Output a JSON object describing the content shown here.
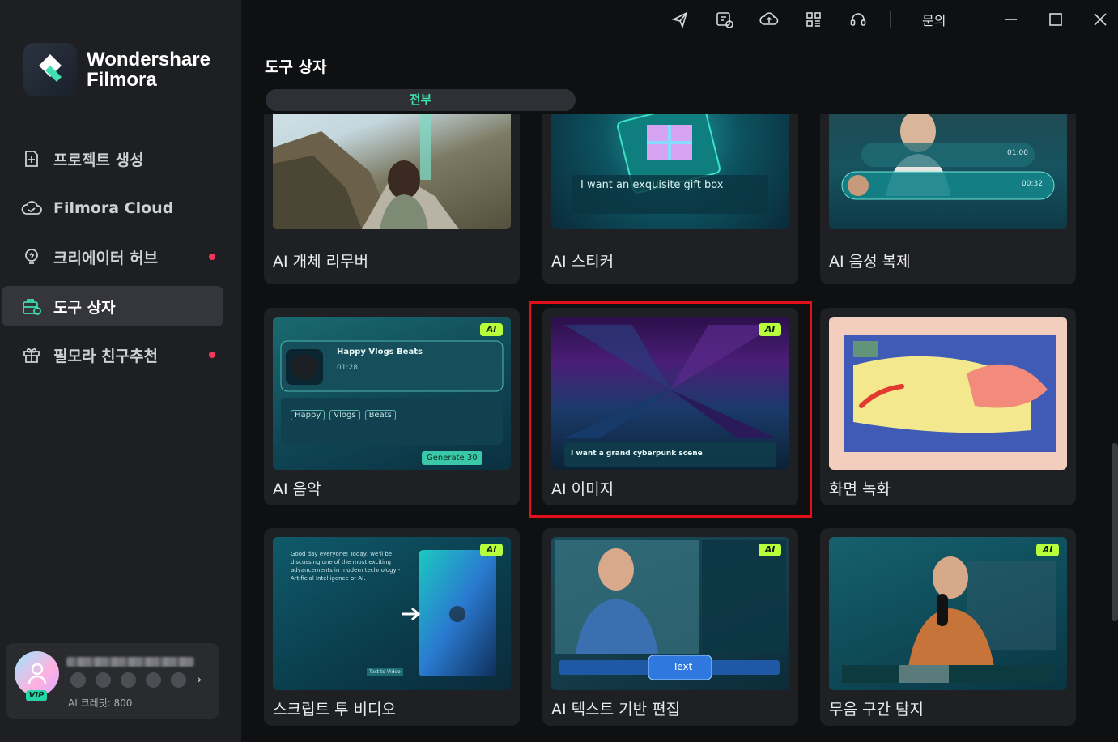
{
  "app": {
    "logo_line1": "Wondershare",
    "logo_line2": "Filmora"
  },
  "sidebar": {
    "items": [
      {
        "label": "프로젝트 생성",
        "icon": "add-project-icon",
        "active": false,
        "dot": false
      },
      {
        "label": "Filmora Cloud",
        "icon": "cloud-icon",
        "active": false,
        "dot": false
      },
      {
        "label": "크리에이터 허브",
        "icon": "bulb-icon",
        "active": false,
        "dot": true
      },
      {
        "label": "도구 상자",
        "icon": "toolbox-icon",
        "active": true,
        "dot": false
      },
      {
        "label": "필모라 친구추천",
        "icon": "gift-icon",
        "active": false,
        "dot": true
      }
    ],
    "user": {
      "vip_label": "VIP",
      "credits": "AI 크레딧: 800"
    }
  },
  "topbar": {
    "icons": [
      "send-icon",
      "feedback-icon",
      "cloud-upload-icon",
      "grid-icon",
      "headset-icon"
    ],
    "inquiry": "문의",
    "window_controls": [
      "minimize-icon",
      "maximize-icon",
      "close-icon"
    ]
  },
  "main": {
    "title": "도구 상자",
    "filter_tab": "전부",
    "ai_badge": "AI",
    "tools": [
      {
        "label": "AI 개체 리무버"
      },
      {
        "label": "AI 스티커",
        "prompt": "I want an exquisite gift box"
      },
      {
        "label": "AI 음성 복제",
        "time1": "01:00",
        "time2": "00:32"
      },
      {
        "label": "AI 음악",
        "track": "Happy Vlogs Beats",
        "time": "01:28",
        "tags": [
          "Happy",
          "Vlogs",
          "Beats"
        ],
        "generate": "Generate",
        "cost": "30"
      },
      {
        "label": "AI 이미지",
        "prompt": "I want a grand cyberpunk scene",
        "highlighted": true
      },
      {
        "label": "화면 녹화"
      },
      {
        "label": "스크립트 투 비디오",
        "script": "Good day everyone! Today, we'll be discussing one of the most exciting advancements in modern technology - Artificial Intelligence or AI.",
        "button": "Text to Video"
      },
      {
        "label": "AI 텍스트 기반 편집",
        "chip": "Text"
      },
      {
        "label": "무음 구간 탐지"
      }
    ]
  },
  "colors": {
    "accent": "#3ee0ad",
    "highlight": "#e3101b",
    "ai_badge": "#b6ff3a",
    "notify_dot": "#f0395a"
  }
}
